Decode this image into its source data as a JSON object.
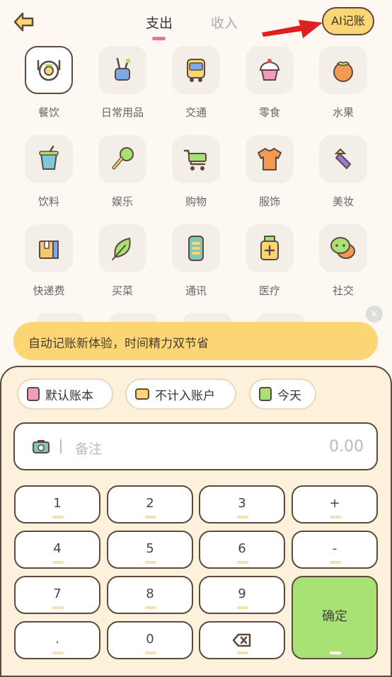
{
  "header": {
    "tabs": [
      {
        "label": "支出",
        "active": true
      },
      {
        "label": "收入",
        "active": false
      }
    ],
    "ai_button": "AI记账",
    "icons": {
      "back": "back-arrow-icon",
      "annotation": "red-arrow-annotation"
    }
  },
  "categories": [
    {
      "label": "餐饮",
      "icon": "food-plate-icon",
      "selected": true
    },
    {
      "label": "日常用品",
      "icon": "toothbrush-cup-icon",
      "selected": false
    },
    {
      "label": "交通",
      "icon": "bus-icon",
      "selected": false
    },
    {
      "label": "零食",
      "icon": "cupcake-icon",
      "selected": false
    },
    {
      "label": "水果",
      "icon": "persimmon-icon",
      "selected": false
    },
    {
      "label": "饮料",
      "icon": "drink-cup-icon",
      "selected": false
    },
    {
      "label": "娱乐",
      "icon": "microphone-icon",
      "selected": false
    },
    {
      "label": "购物",
      "icon": "shopping-cart-icon",
      "selected": false
    },
    {
      "label": "服饰",
      "icon": "shirt-icon",
      "selected": false
    },
    {
      "label": "美妆",
      "icon": "lipstick-icon",
      "selected": false
    },
    {
      "label": "快递费",
      "icon": "parcel-box-icon",
      "selected": false
    },
    {
      "label": "买菜",
      "icon": "vegetable-leaf-icon",
      "selected": false
    },
    {
      "label": "通讯",
      "icon": "mobile-phone-icon",
      "selected": false
    },
    {
      "label": "医疗",
      "icon": "medicine-bottle-icon",
      "selected": false
    },
    {
      "label": "社交",
      "icon": "chat-bubbles-icon",
      "selected": false
    }
  ],
  "banner": {
    "text": "自动记账新体验，时间精力双节省",
    "close": "×"
  },
  "chips": [
    {
      "label": "默认账本",
      "icon": "notebook-icon",
      "color": "#f29bc0"
    },
    {
      "label": "不计入账户",
      "icon": "wallet-icon",
      "color": "#fcd674"
    },
    {
      "label": "今天",
      "icon": "calendar-icon",
      "color": "#a9e274"
    }
  ],
  "note": {
    "placeholder": "备注",
    "amount": "0.00",
    "icon": "camera-icon"
  },
  "keypad": {
    "keys": [
      "1",
      "2",
      "3",
      "+",
      "4",
      "5",
      "6",
      "-",
      "7",
      "8",
      "9",
      ".",
      "0"
    ],
    "backspace_icon": "backspace-icon",
    "confirm": "确定"
  },
  "colors": {
    "accent_yellow": "#fcd674",
    "accent_pink": "#f06fa0",
    "confirm_green": "#a9e274",
    "outline": "#5b4a3d"
  }
}
